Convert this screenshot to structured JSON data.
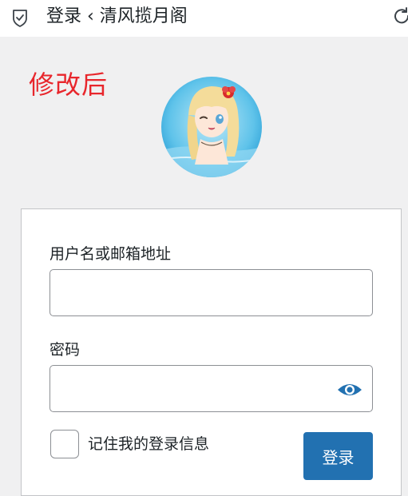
{
  "header": {
    "title": "登录 ‹ 清风揽月阁",
    "shield_icon": "shield-check-icon",
    "reload_icon": "reload-icon"
  },
  "annotation": {
    "text": "修改后",
    "color": "#e8262c"
  },
  "avatar": {
    "description": "anime-style avatar"
  },
  "form": {
    "username_label": "用户名或邮箱地址",
    "username_value": "",
    "password_label": "密码",
    "password_value": "",
    "toggle_password_icon": "eye-icon",
    "remember_label": "记住我的登录信息",
    "remember_checked": false,
    "submit_label": "登录"
  },
  "colors": {
    "accent": "#2271b1",
    "background": "#f0f0f1",
    "annotation": "#e8262c"
  }
}
